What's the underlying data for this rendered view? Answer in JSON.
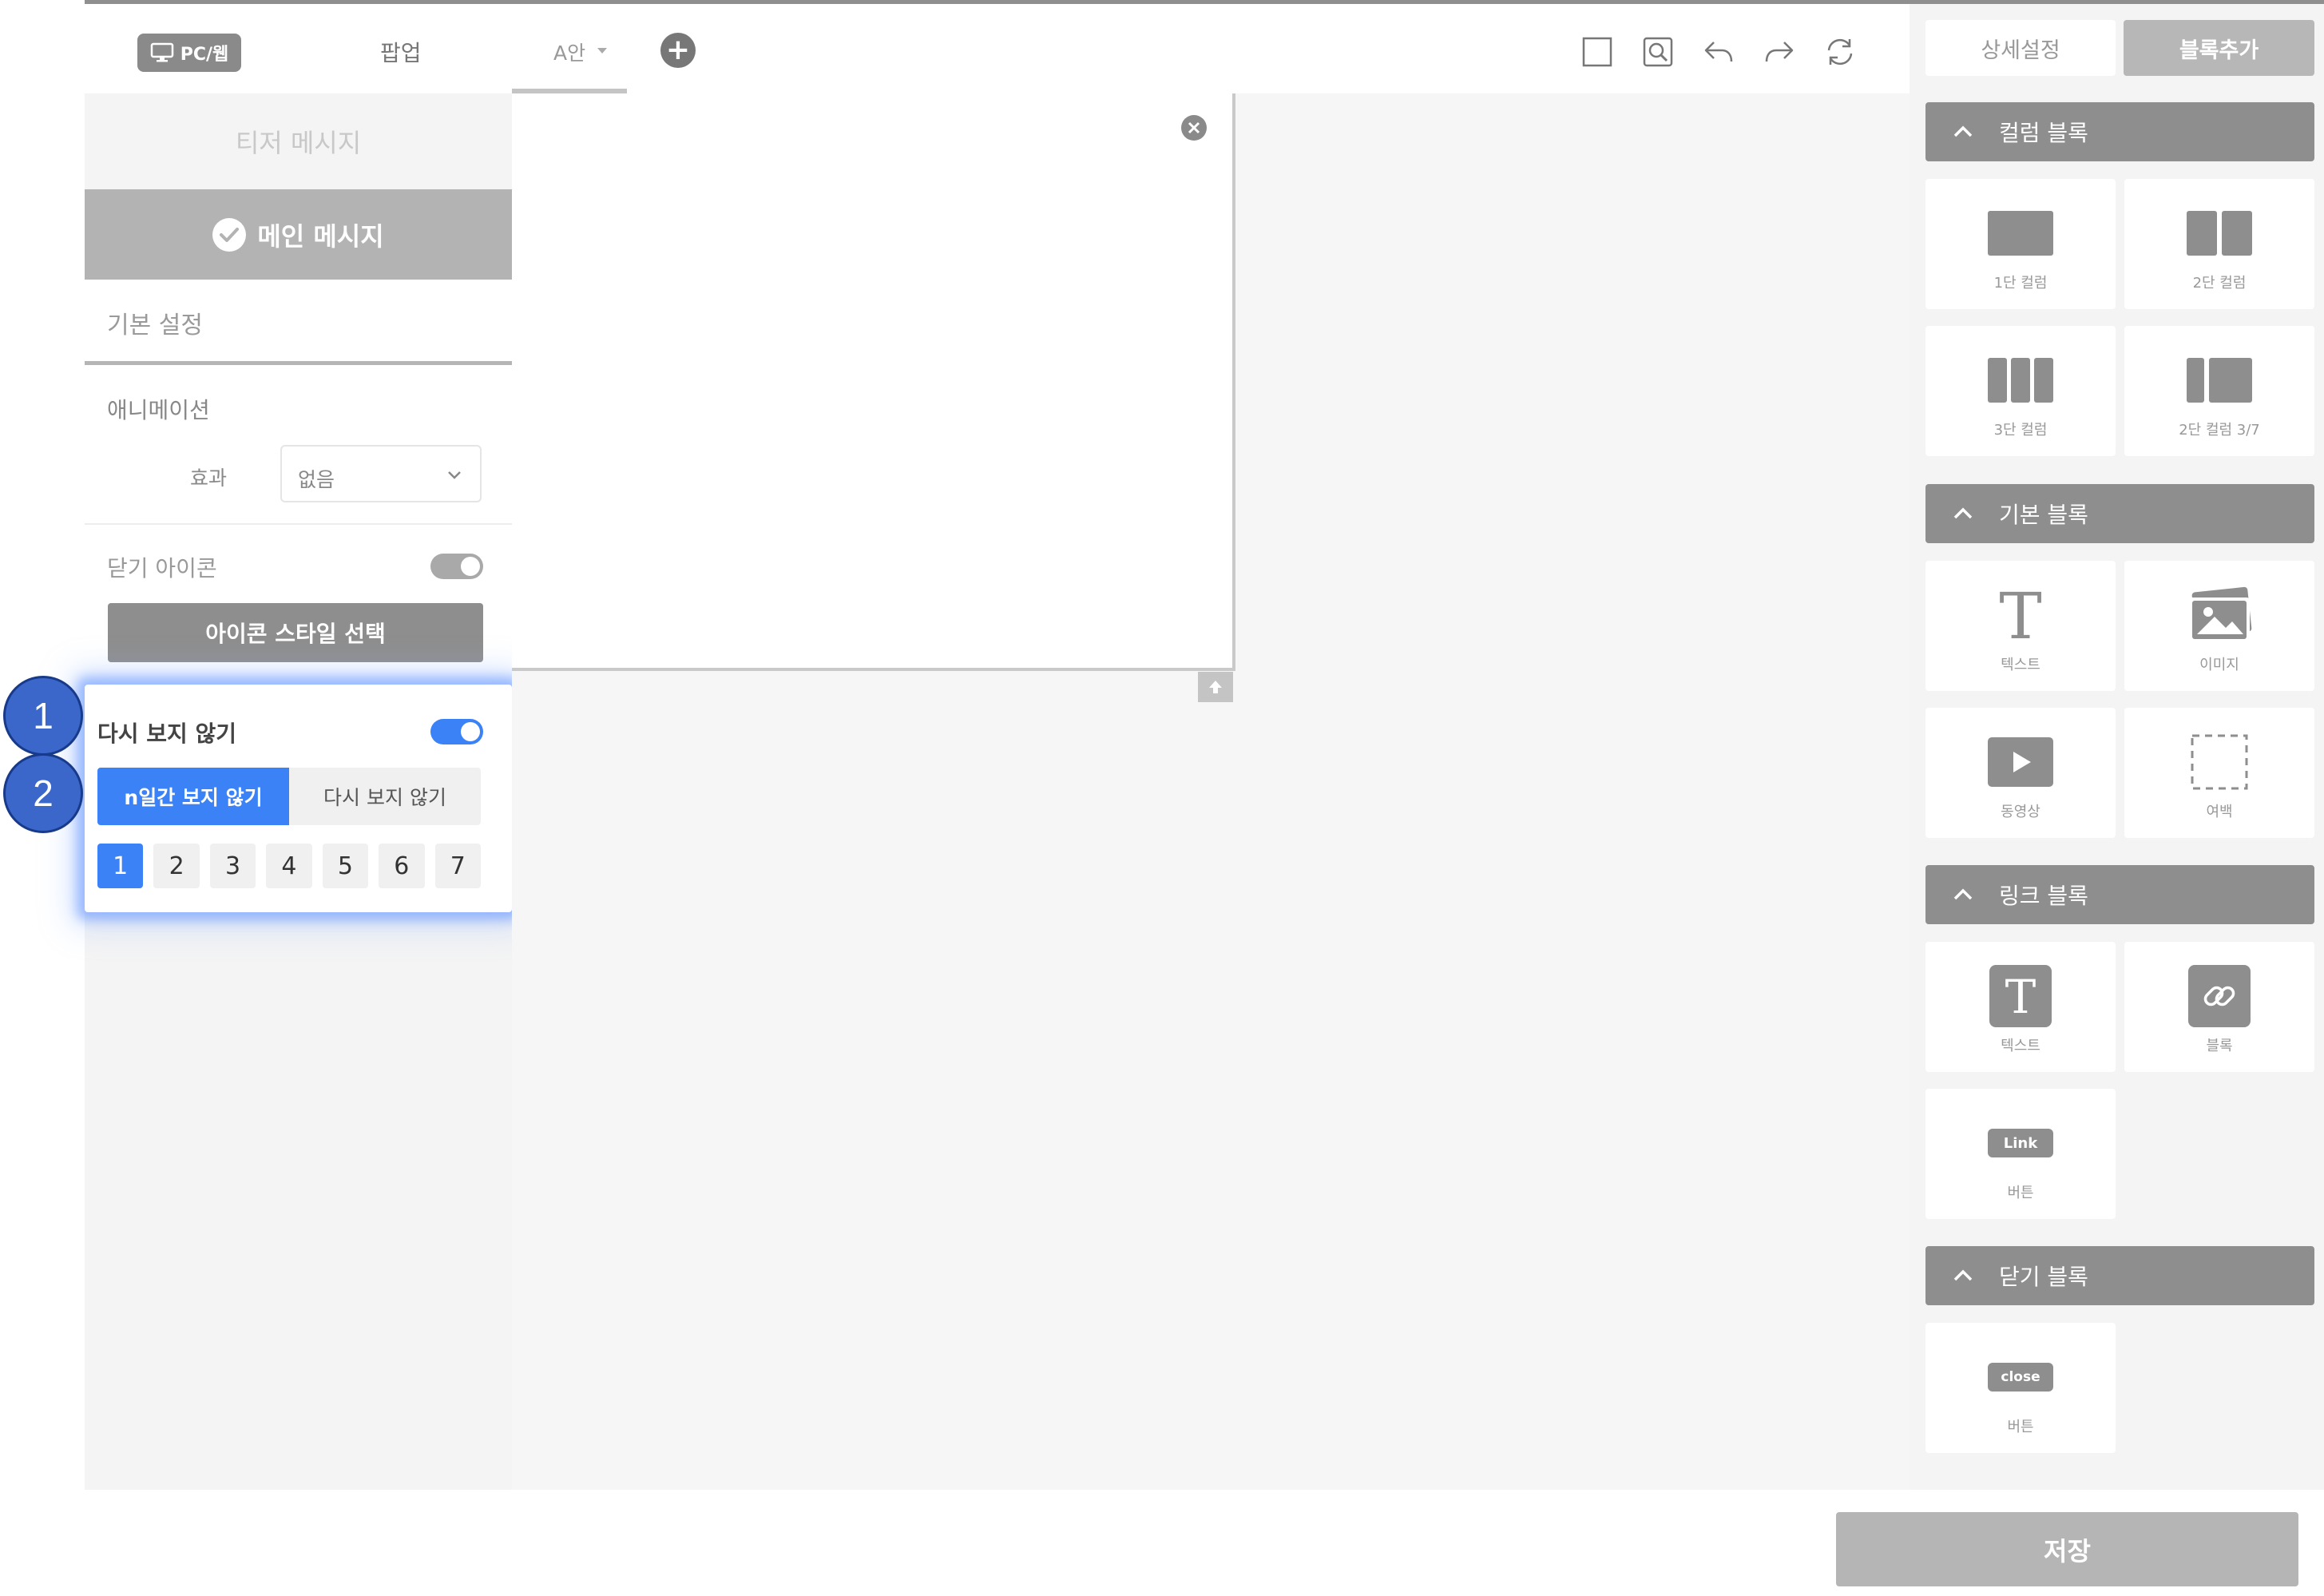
{
  "left_header": {
    "device_badge": "PC/웹",
    "popup_tab": "팝업"
  },
  "left_panel": {
    "teaser_message": "티저 메시지",
    "main_message": "메인 메시지",
    "basic_setting": "기본 설정",
    "animation": {
      "title": "애니메이션",
      "effect_label": "효과",
      "effect_value": "없음"
    },
    "close_icon": {
      "title": "닫기 아이콘",
      "toggle_on": true,
      "style_button": "아이콘 스타일 선택"
    },
    "dont_show_again": {
      "title": "다시 보지 않기",
      "toggle_on": true,
      "options": [
        "n일간 보지 않기",
        "다시 보지 않기"
      ],
      "selected_option": 0,
      "days": [
        "1",
        "2",
        "3",
        "4",
        "5",
        "6",
        "7"
      ],
      "selected_day": "1"
    }
  },
  "steps": [
    "1",
    "2"
  ],
  "version_bar": {
    "tab": "A안"
  },
  "right_panel": {
    "tabs": {
      "detail": "상세설정",
      "add_block": "블록추가"
    },
    "groups": {
      "column": {
        "title": "컬럼 블록",
        "items": [
          "1단 컬럼",
          "2단 컬럼",
          "3단 컬럼",
          "2단 컬럼 3/7"
        ]
      },
      "basic": {
        "title": "기본 블록",
        "items": [
          "텍스트",
          "이미지",
          "동영상",
          "여백"
        ]
      },
      "link": {
        "title": "링크 블록",
        "items": [
          "텍스트",
          "블록",
          "버튼"
        ],
        "button_text": "Link"
      },
      "close": {
        "title": "닫기 블록",
        "items": [
          "버튼"
        ],
        "button_text": "close"
      }
    }
  },
  "footer": {
    "save": "저장"
  },
  "colors": {
    "accent": "#3b82f6",
    "step_marker": "#3a67c9",
    "dark_gray": "#8e8e8e"
  }
}
